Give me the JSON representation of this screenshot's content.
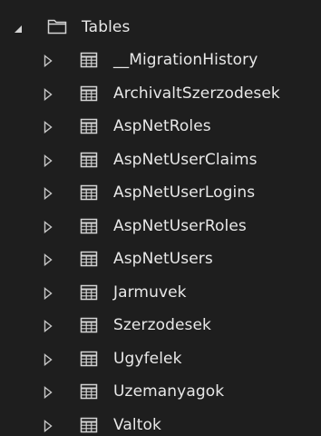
{
  "folder": {
    "label": "Tables",
    "expanded": true,
    "icon": "folder-icon"
  },
  "tables": [
    {
      "label": "__MigrationHistory",
      "icon": "table-icon"
    },
    {
      "label": "ArchivaltSzerzodesek",
      "icon": "table-icon"
    },
    {
      "label": "AspNetRoles",
      "icon": "table-icon"
    },
    {
      "label": "AspNetUserClaims",
      "icon": "table-icon"
    },
    {
      "label": "AspNetUserLogins",
      "icon": "table-icon"
    },
    {
      "label": "AspNetUserRoles",
      "icon": "table-icon"
    },
    {
      "label": "AspNetUsers",
      "icon": "table-icon"
    },
    {
      "label": "Jarmuvek",
      "icon": "table-icon"
    },
    {
      "label": "Szerzodesek",
      "icon": "table-icon"
    },
    {
      "label": "Ugyfelek",
      "icon": "table-icon"
    },
    {
      "label": "Uzemanyagok",
      "icon": "table-icon"
    },
    {
      "label": "Valtok",
      "icon": "table-icon"
    }
  ],
  "colors": {
    "background": "#1e1e1e",
    "text": "#e8e8e8",
    "icon": "#d4d4d4",
    "arrow": "#c8c8c8"
  }
}
